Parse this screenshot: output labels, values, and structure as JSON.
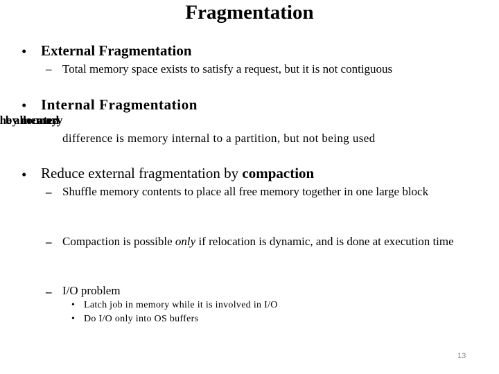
{
  "slide": {
    "title": "Fragmentation",
    "page_number": "13",
    "items": [
      {
        "heading": "External Fragmentation",
        "sub": [
          "Total memory space exists to satisfy a request, but it is not contiguous"
        ]
      },
      {
        "heading": "Internal Fragmentation",
        "overlapped_words": [
          "the",
          "by",
          "allocated",
          "memory",
          "may"
        ],
        "sub": [
          "difference is memory internal to a partition, but not being used"
        ]
      },
      {
        "heading_prefix": "Reduce external fragmentation by ",
        "heading_bold": "compaction",
        "sub": [
          "Shuffle memory contents to place all free memory together in one large block",
          {
            "before": "Compaction is possible ",
            "italic": "only",
            "after": " if relocation is dynamic, and is done at execution time"
          },
          "I/O problem"
        ],
        "subsub": [
          "Latch job in memory while it is involved in I/O",
          "Do I/O only into OS buffers"
        ]
      }
    ]
  },
  "glyphs": {
    "bullet": "•",
    "dash": "–"
  }
}
